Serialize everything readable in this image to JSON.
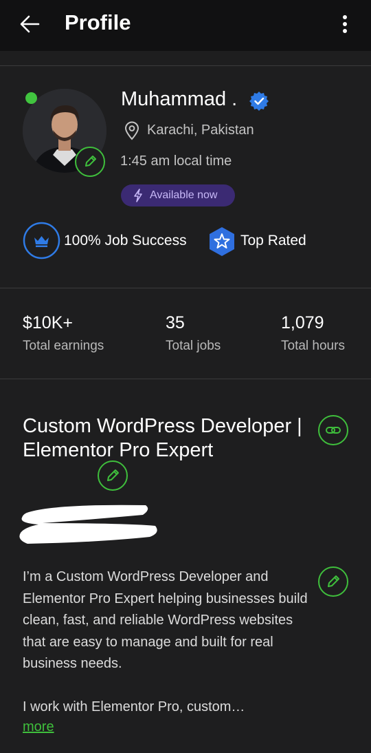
{
  "header": {
    "title": "Profile"
  },
  "profile": {
    "name": "Muhammad .",
    "location": "Karachi, Pakistan",
    "local_time": "1:45 am local time",
    "availability": "Available now",
    "online": true
  },
  "badges": {
    "job_success": "100% Job Success",
    "top_rated": "Top Rated"
  },
  "stats": [
    {
      "value": "$10K+",
      "label": "Total earnings"
    },
    {
      "value": "35",
      "label": "Total jobs"
    },
    {
      "value": "1,079",
      "label": "Total hours"
    }
  ],
  "headline": "Custom WordPress Developer | Elementor Pro Expert",
  "overview": {
    "paragraph1": "I’m a Custom WordPress Developer and Elementor Pro Expert helping businesses build clean, fast, and reliable WordPress websites that are easy to manage and built for real business needs.",
    "paragraph2": "I work with Elementor Pro, custom…",
    "more_label": "more"
  },
  "colors": {
    "accent": "#3fbf3c",
    "background": "#1e1e1f",
    "availability_bg": "#3b2a73",
    "verified": "#2f7be6"
  },
  "icons": [
    "back-arrow-icon",
    "more-vert-icon",
    "pencil-icon",
    "verified-check-icon",
    "location-pin-icon",
    "lightning-icon",
    "crown-icon",
    "star-icon",
    "link-icon"
  ]
}
